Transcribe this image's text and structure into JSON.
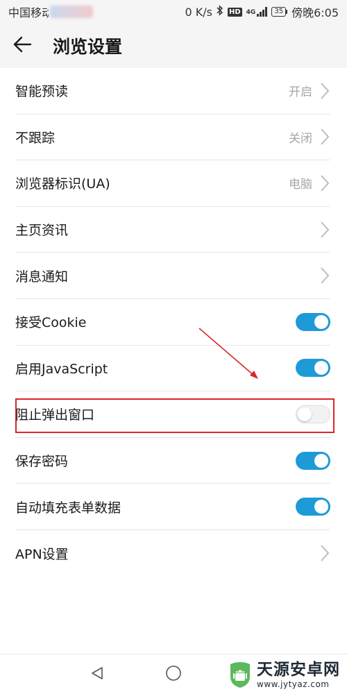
{
  "status_bar": {
    "carrier": "中国移动",
    "speed": "0 K/s",
    "hd_badge": "HD",
    "network": "4G",
    "battery": "35",
    "time": "傍晚6:05"
  },
  "header": {
    "title": "浏览设置",
    "back_icon": "arrow-left-icon"
  },
  "settings": [
    {
      "label": "智能预读",
      "type": "nav",
      "value": "开启"
    },
    {
      "label": "不跟踪",
      "type": "nav",
      "value": "关闭"
    },
    {
      "label": "浏览器标识(UA)",
      "type": "nav",
      "value": "电脑"
    },
    {
      "label": "主页资讯",
      "type": "nav",
      "value": ""
    },
    {
      "label": "消息通知",
      "type": "nav",
      "value": ""
    },
    {
      "label": "接受Cookie",
      "type": "toggle",
      "enabled": true
    },
    {
      "label": "启用JavaScript",
      "type": "toggle",
      "enabled": true
    },
    {
      "label": "阻止弹出窗口",
      "type": "toggle",
      "enabled": false
    },
    {
      "label": "保存密码",
      "type": "toggle",
      "enabled": true
    },
    {
      "label": "自动填充表单数据",
      "type": "toggle",
      "enabled": true
    },
    {
      "label": "APN设置",
      "type": "nav",
      "value": ""
    }
  ],
  "nav_bar": {
    "back_icon": "triangle-back-icon",
    "home_icon": "circle-home-icon"
  },
  "watermark": {
    "title": "天源安卓网",
    "url": "www.jytyaz.com"
  },
  "colors": {
    "toggle_on": "#1e9ad6",
    "toggle_off": "#f2f2f2",
    "annotation": "#d9252b",
    "secondary_text": "#a6a6a6"
  }
}
